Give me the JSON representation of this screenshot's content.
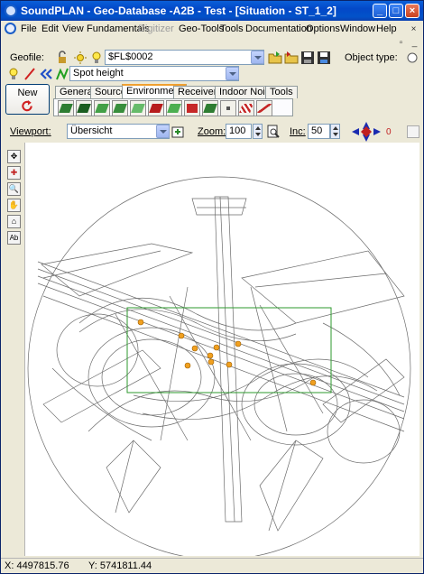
{
  "window": {
    "title": "SoundPLAN - Geo-Database -A2B - Test - [Situation - ST_1_2]",
    "minimize_label": "_",
    "maximize_label": "□",
    "close_label": "×"
  },
  "menu": {
    "items": [
      "File",
      "Edit",
      "View",
      "Fundamentals",
      "Digitizer",
      "Geo-Tools",
      "Tools",
      "Documentation",
      "Options",
      "Window",
      "Help"
    ],
    "disabled": [
      "Digitizer"
    ],
    "mdi_minimize": "_",
    "mdi_restore": "▫",
    "mdi_close": "×"
  },
  "geofile": {
    "label": "Geofile:",
    "value": "$FL$0002",
    "object_type_label": "Object type:"
  },
  "object": {
    "value": "Spot height"
  },
  "new_button": {
    "label": "New"
  },
  "tabs": [
    "General",
    "Source",
    "Environment",
    "Receivers",
    "Indoor Noise",
    "Tools"
  ],
  "active_tab": "Environment",
  "viewport": {
    "label": "Viewport:",
    "value": "Übersicht",
    "zoom_label": "Zoom:",
    "zoom_value": "100",
    "inc_label": "Inc:",
    "inc_value": "50",
    "rotation_value": "0"
  },
  "left_tools": [
    "pan-icon",
    "crosshair-icon",
    "zoom-icon",
    "hand-icon",
    "layer-icon",
    "text-label-icon"
  ],
  "left_tool_glyphs": [
    "✥",
    "✚",
    "🔍",
    "✋",
    "⌂",
    "Ab"
  ],
  "colors": {
    "selection_rect": "#2e9a2e",
    "points": "#f0a020",
    "title_bar": "#0348c8"
  },
  "status": {
    "x": "X: 4497815.76",
    "y": "Y: 5741811.44"
  }
}
